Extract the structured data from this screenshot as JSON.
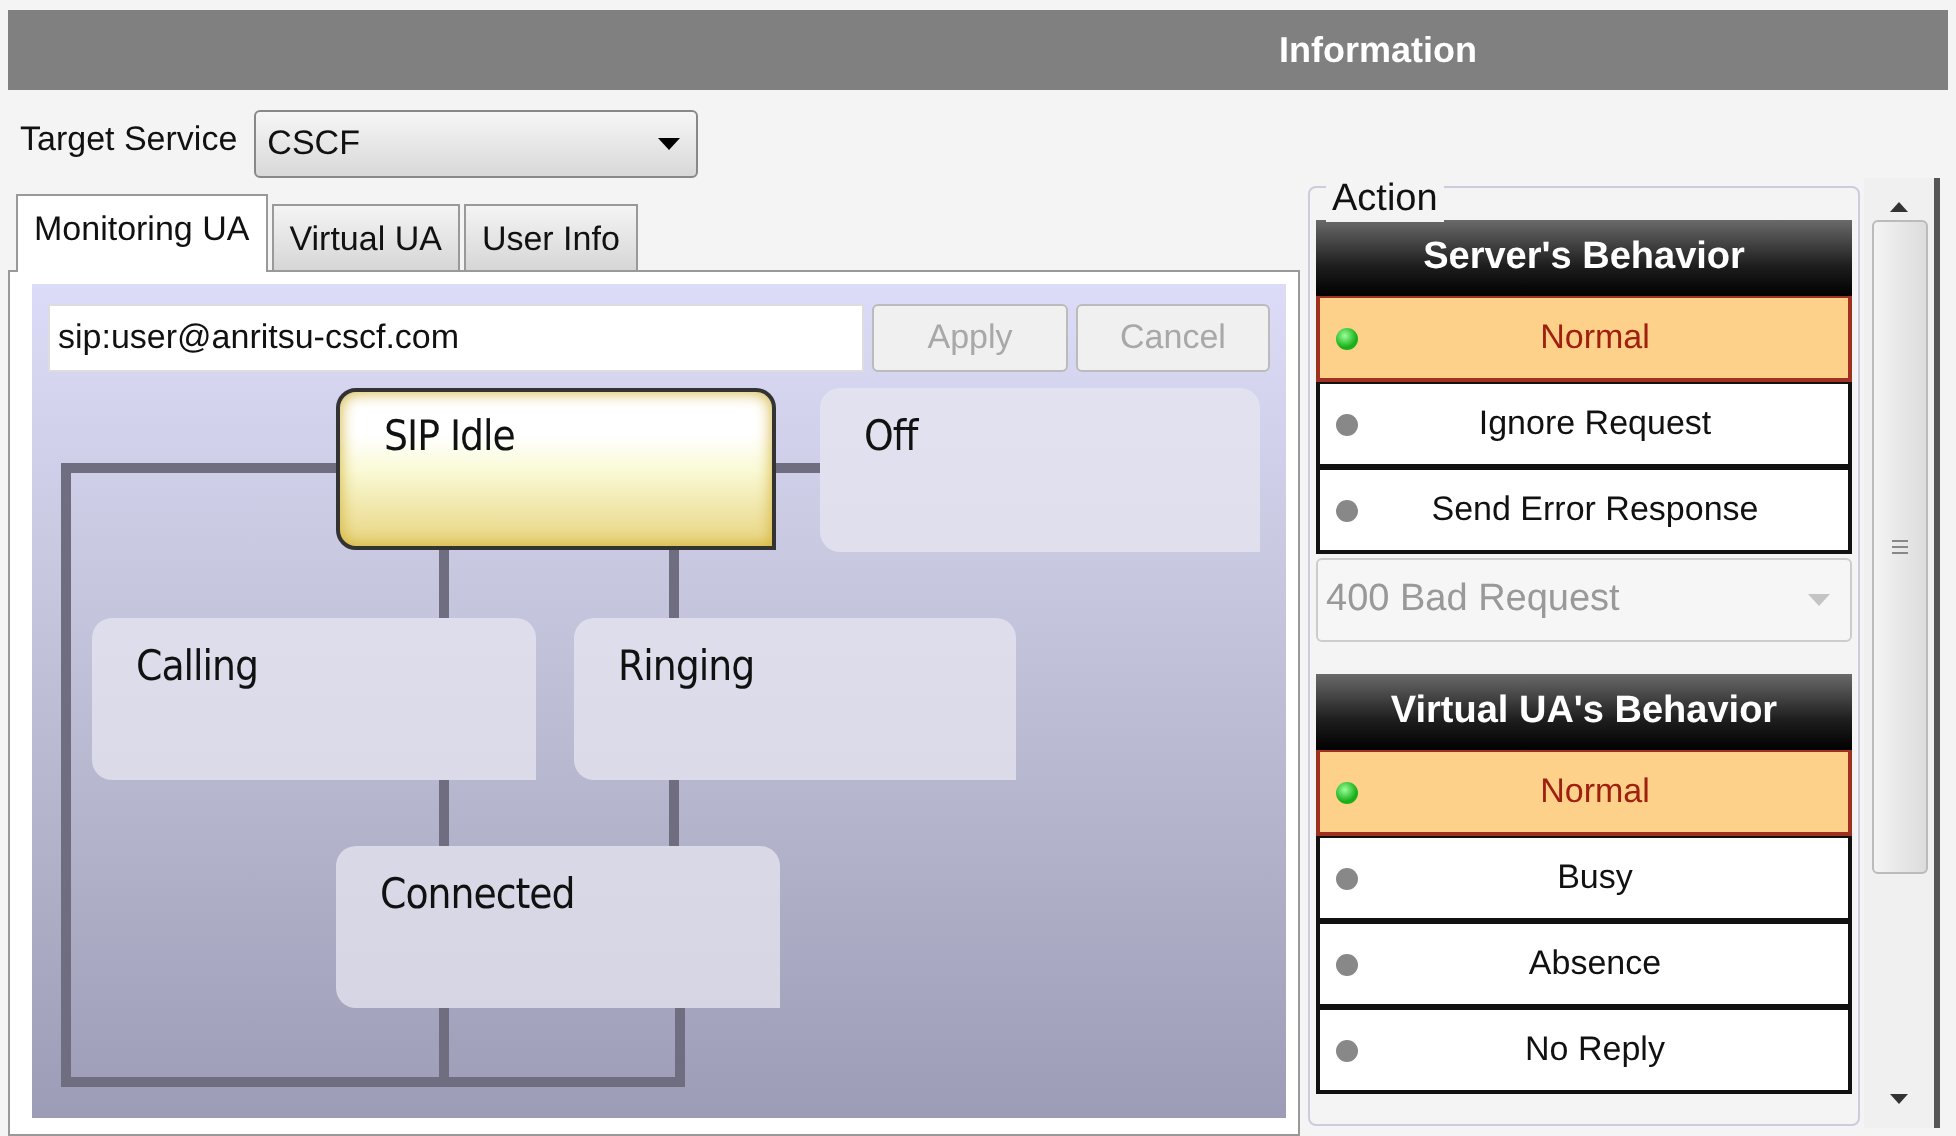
{
  "header": {
    "title": "Information"
  },
  "target_service": {
    "label": "Target Service",
    "value": "CSCF"
  },
  "tabs": [
    {
      "label": "Monitoring UA",
      "selected": true
    },
    {
      "label": "Virtual UA",
      "selected": false
    },
    {
      "label": "User Info",
      "selected": false
    }
  ],
  "uri_field": {
    "value": "sip:user@anritsu-cscf.com"
  },
  "buttons": [
    {
      "label": "Apply",
      "disabled": true
    },
    {
      "label": "Cancel",
      "disabled": true
    }
  ],
  "diagram": {
    "states": [
      {
        "label": "SIP Idle",
        "selected": true
      },
      {
        "label": "Off",
        "selected": false
      },
      {
        "label": "Calling",
        "selected": false
      },
      {
        "label": "Ringing",
        "selected": false
      },
      {
        "label": "Connected",
        "selected": false
      }
    ]
  },
  "action": {
    "title": "Action",
    "groups": [
      {
        "title": "Server's Behavior",
        "items": [
          {
            "label": "Normal",
            "selected": true
          },
          {
            "label": "Ignore Request",
            "selected": false
          },
          {
            "label": "Send Error Response",
            "selected": false
          }
        ],
        "dropdown": {
          "value": "400 Bad Request",
          "disabled": true
        }
      },
      {
        "title": "Virtual UA's Behavior",
        "items": [
          {
            "label": "Normal",
            "selected": true
          },
          {
            "label": "Busy",
            "selected": false
          },
          {
            "label": "Absence",
            "selected": false
          },
          {
            "label": "No Reply",
            "selected": false
          }
        ]
      }
    ]
  }
}
